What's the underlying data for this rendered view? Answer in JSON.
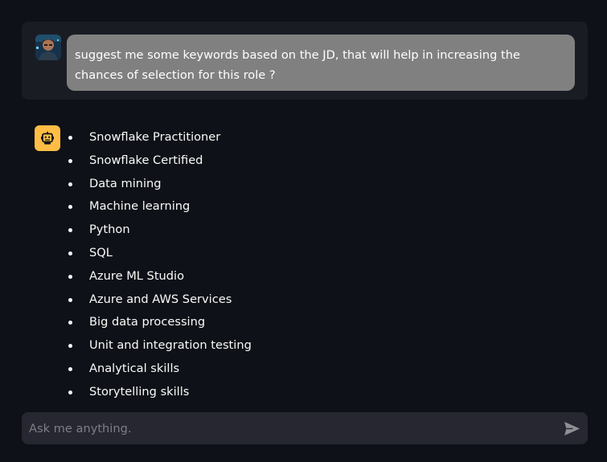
{
  "user_message": {
    "text": "suggest me some keywords based on the JD, that will help in increasing the chances of selection for this role ?"
  },
  "assistant_message": {
    "items": [
      "Snowflake Practitioner",
      "Snowflake Certified",
      "Data mining",
      "Machine learning",
      "Python",
      "SQL",
      "Azure ML Studio",
      "Azure and AWS Services",
      "Big data processing",
      "Unit and integration testing",
      "Analytical skills",
      "Storytelling skills"
    ]
  },
  "chat_input": {
    "placeholder": "Ask me anything.",
    "value": ""
  },
  "icons": {
    "user_avatar": "user-avatar-icon",
    "bot_avatar": "robot-icon",
    "send": "send-icon"
  },
  "colors": {
    "background": "#0e1117",
    "user_block": "#1a1c24",
    "user_bubble": "#808080",
    "bot_avatar": "#ffbd45",
    "input_bg": "#262730"
  }
}
